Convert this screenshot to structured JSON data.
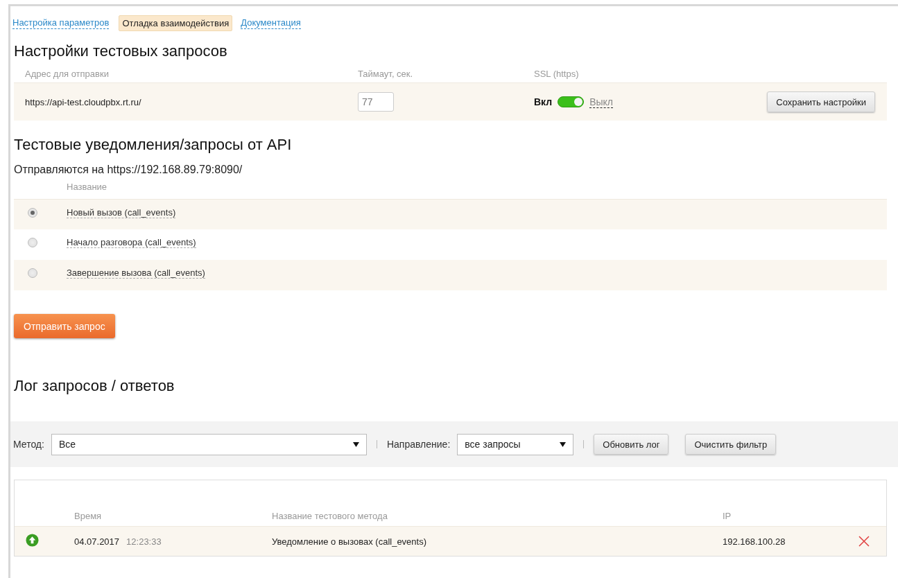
{
  "tabs": [
    {
      "label": "Настройка параметров",
      "selected": false
    },
    {
      "label": "Отладка взаимодействия",
      "selected": true
    },
    {
      "label": "Документация",
      "selected": false
    }
  ],
  "settings": {
    "title": "Настройки тестовых запросов",
    "columns": [
      "Адрес для отправки",
      "Таймаут, сек.",
      "SSL (https)"
    ],
    "address": "https://api-test.cloudpbx.rt.ru/",
    "timeout": "77",
    "ssl_on_label": "Вкл",
    "ssl_off_label": "Выкл",
    "ssl": true,
    "save_button": "Сохранить настройки"
  },
  "notifications": {
    "title": "Тестовые уведомления/запросы от API",
    "subtitle": "Отправляются на https://192.168.89.79:8090/",
    "column": "Название",
    "items": [
      {
        "label": "Новый вызов (call_events)",
        "selected": true
      },
      {
        "label": "Начало разговора (call_events)",
        "selected": false
      },
      {
        "label": "Завершение вызова (call_events)",
        "selected": false
      }
    ],
    "send_button": "Отправить запрос"
  },
  "log": {
    "title": "Лог запросов / ответов",
    "filters": {
      "method_label": "Метод:",
      "method_value": "Все",
      "direction_label": "Направление:",
      "direction_value": "все запросы",
      "refresh_button": "Обновить лог",
      "clear_button": "Очистить фильтр"
    },
    "columns": [
      "Время",
      "Название тестового метода",
      "IP"
    ],
    "rows": [
      {
        "kind": "outgoing",
        "date": "04.07.2017",
        "time": "12:23:33",
        "method": "Уведомление о вызовах (call_events)",
        "ip": "192.168.100.28"
      }
    ]
  }
}
